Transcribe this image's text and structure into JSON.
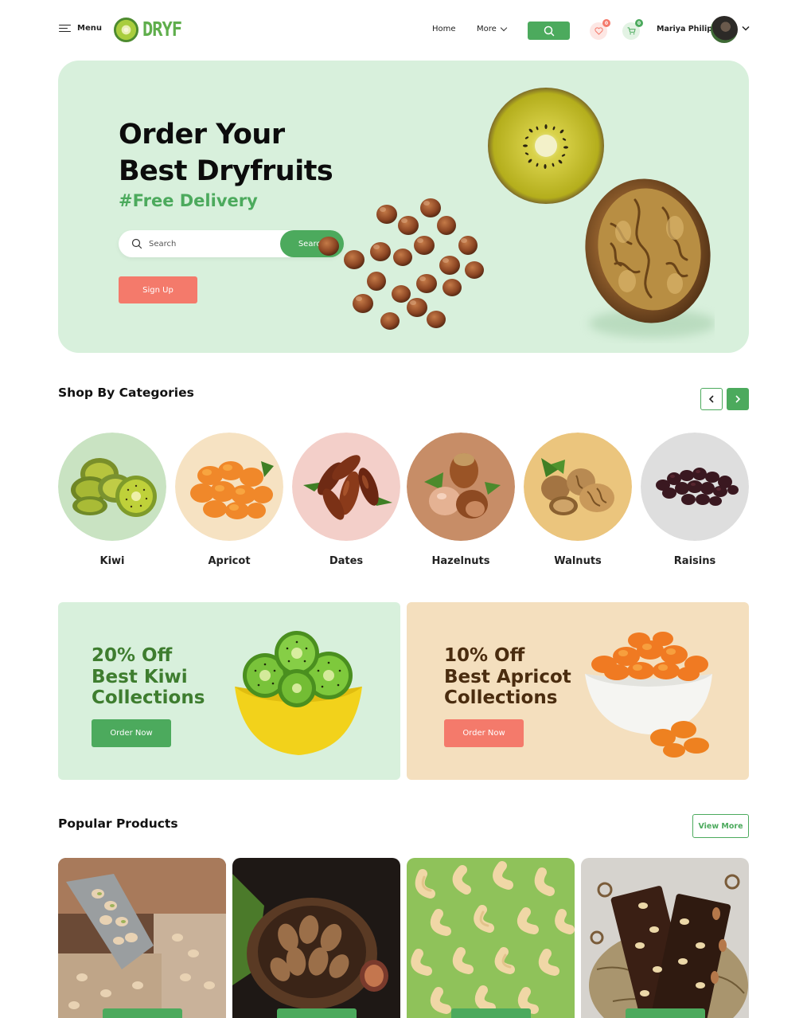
{
  "header": {
    "menu_label": "Menu",
    "logo_text": "DRYF",
    "nav": {
      "home": "Home",
      "more": "More"
    },
    "wishlist_count": "0",
    "cart_count": "0",
    "user_name": "Mariya Philip"
  },
  "hero": {
    "title_line1": "Order Your",
    "title_line2": "Best Dryfruits",
    "tagline": "#Free Delivery",
    "search_placeholder": "Search",
    "search_button": "Search",
    "signup_button": "Sign Up"
  },
  "categories": {
    "title": "Shop By Categories",
    "items": [
      {
        "label": "Kiwi",
        "bg": "#c9e3c2"
      },
      {
        "label": "Apricot",
        "bg": "#f6e2c2"
      },
      {
        "label": "Dates",
        "bg": "#f3cfc9"
      },
      {
        "label": "Hazelnuts",
        "bg": "#c78d67"
      },
      {
        "label": "Walnuts",
        "bg": "#ebc57d"
      },
      {
        "label": "Raisins",
        "bg": "#dedede"
      }
    ]
  },
  "promos": [
    {
      "line1": "20% Off",
      "line2": "Best Kiwi",
      "line3": "Collections",
      "button": "Order Now"
    },
    {
      "line1": "10% Off",
      "line2": "Best Apricot",
      "line3": "Collections",
      "button": "Order Now"
    }
  ],
  "popular": {
    "title": "Popular Products",
    "view_more": "View More"
  },
  "colors": {
    "brand_green": "#4caa5d",
    "coral": "#f47a6b",
    "hero_bg": "#d8f0dc",
    "apricot_bg": "#f4dfbe"
  },
  "icons": [
    "menu-icon",
    "logo-kiwi-icon",
    "chevron-down-icon",
    "search-icon",
    "heart-icon",
    "cart-icon",
    "chevron-left-icon",
    "chevron-right-icon"
  ]
}
